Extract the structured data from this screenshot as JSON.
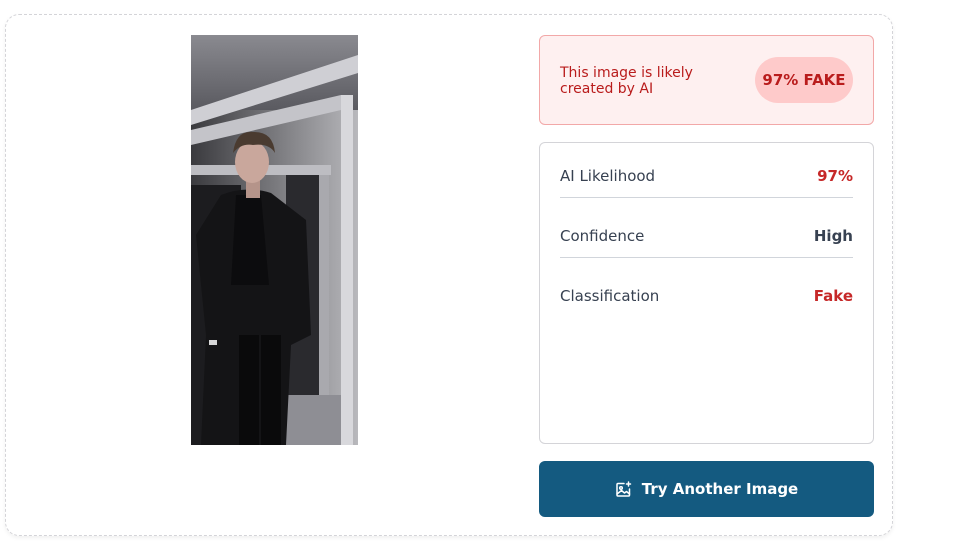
{
  "alert": {
    "message": "This image is likely created by AI",
    "badge": "97% FAKE"
  },
  "metrics": [
    {
      "label": "AI Likelihood",
      "value": "97%"
    },
    {
      "label": "Confidence",
      "value": "High"
    },
    {
      "label": "Classification",
      "value": "Fake"
    }
  ],
  "actions": {
    "try_another_label": "Try Another Image",
    "try_another_icon": "image-plus-icon"
  },
  "colors": {
    "fake_red": "#c62828",
    "alert_bg": "#fef0f0",
    "badge_bg": "#fecaca",
    "button_blue": "#145a80"
  }
}
